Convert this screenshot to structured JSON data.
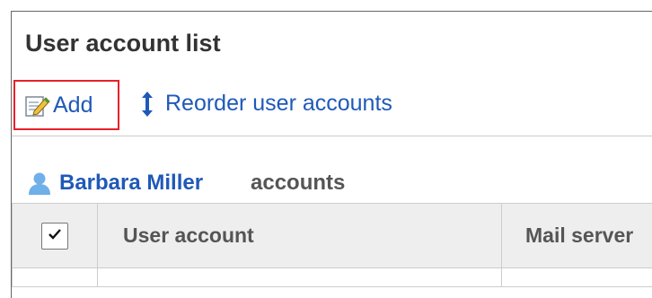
{
  "page": {
    "title": "User account list"
  },
  "toolbar": {
    "add_label": "Add",
    "add_icon": "edit-document-icon",
    "reorder_label": "Reorder user accounts",
    "reorder_icon": "vertical-arrows-icon"
  },
  "owner": {
    "icon": "user-icon",
    "name": "Barbara Miller",
    "suffix": "accounts"
  },
  "table": {
    "columns": [
      "User account",
      "Mail server"
    ],
    "select_all_checked": true
  },
  "colors": {
    "link": "#1f59b8",
    "highlight_border": "#e8202a",
    "header_bg": "#eeeeee"
  }
}
